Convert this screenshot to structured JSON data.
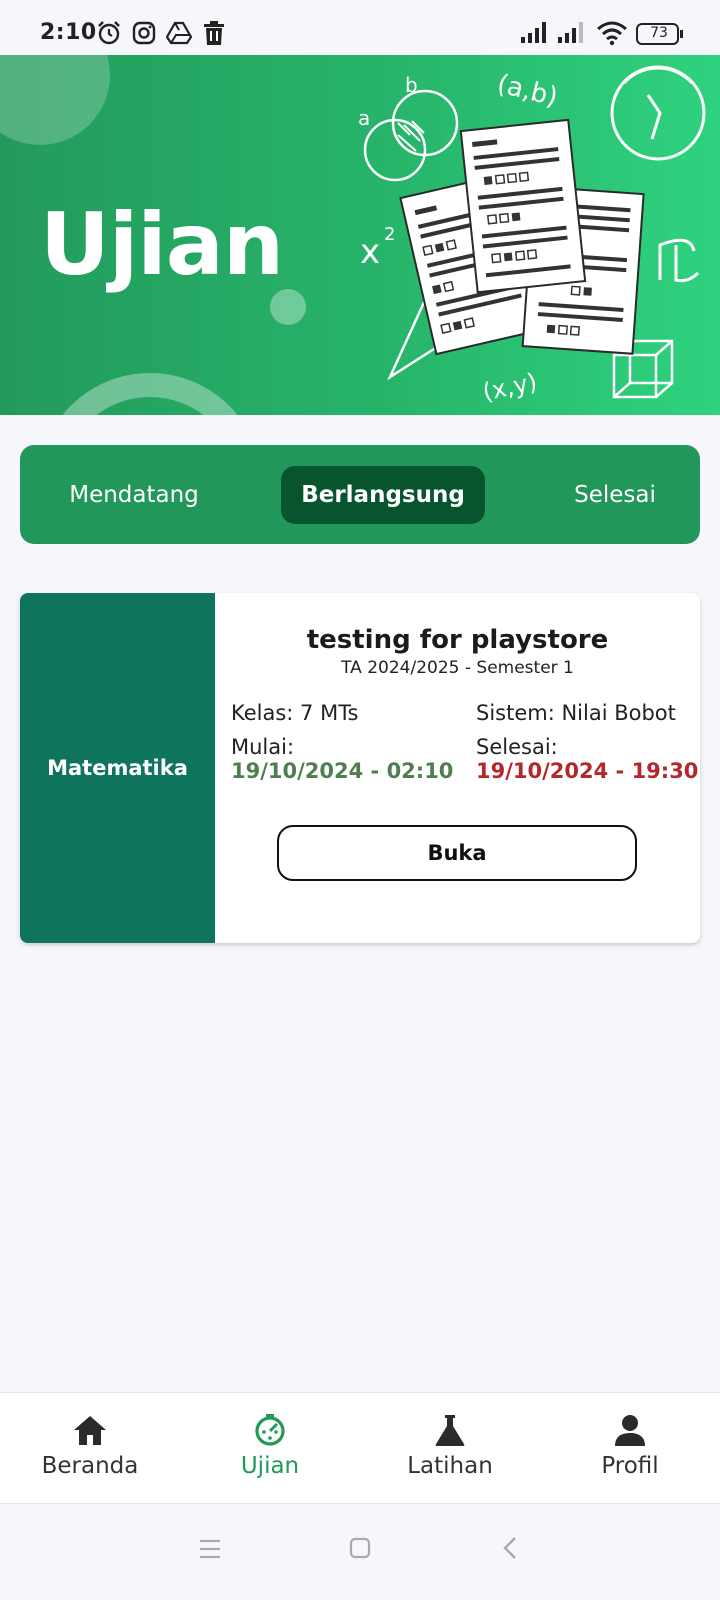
{
  "status_bar": {
    "time": "2:10",
    "battery": "73",
    "icons": [
      "alarm-icon",
      "instagram-icon",
      "drive-icon",
      "trash-icon",
      "signal-icon",
      "signal-icon",
      "wifi-icon",
      "battery-icon"
    ]
  },
  "hero": {
    "title": "Ujian",
    "background_colors": [
      "#239a5c",
      "#2fd27f"
    ]
  },
  "tabs": [
    {
      "label": "Mendatang",
      "active": false
    },
    {
      "label": "Berlangsung",
      "active": true
    },
    {
      "label": "Selesai",
      "active": false
    }
  ],
  "exam": {
    "subject": "Matematika",
    "title": "testing for playstore",
    "term": "TA 2024/2025 - Semester 1",
    "kelas": "Kelas: 7 MTs",
    "sistem": "Sistem: Nilai Bobot",
    "start_label": "Mulai:",
    "start_value": "19/10/2024 - 02:10",
    "end_label": "Selesai:",
    "end_value": "19/10/2024 - 19:30",
    "open_button": "Buka"
  },
  "bottom_nav": [
    {
      "label": "Beranda",
      "icon": "home-icon",
      "active": false
    },
    {
      "label": "Ujian",
      "icon": "timer-icon",
      "active": true
    },
    {
      "label": "Latihan",
      "icon": "flask-icon",
      "active": false
    },
    {
      "label": "Profil",
      "icon": "person-icon",
      "active": false
    }
  ],
  "colors": {
    "brand_green": "#21975a",
    "active_tab": "#08542f",
    "subject_panel": "#0f745c",
    "start_date": "#4f7f4e",
    "end_date": "#b3282d",
    "nav_active": "#1f9a57"
  }
}
